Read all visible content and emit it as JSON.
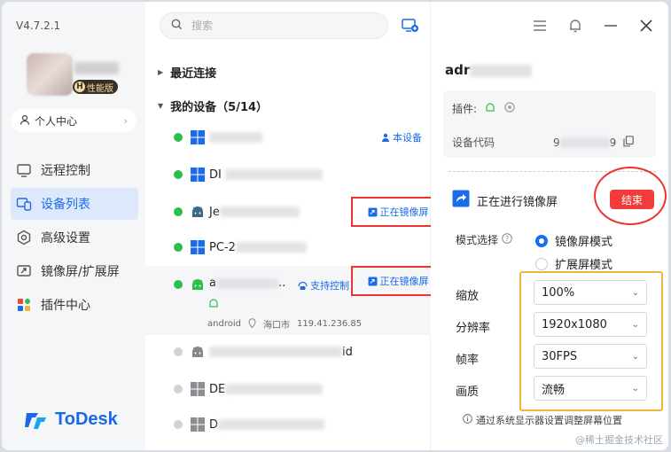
{
  "app": {
    "version": "V4.7.2.1",
    "badge": "性能版",
    "badge_letter": "H",
    "personal_center": "个人中心",
    "logo_text": "ToDesk"
  },
  "sidebar": {
    "items": [
      {
        "label": "远程控制",
        "icon": "remote-control-icon"
      },
      {
        "label": "设备列表",
        "icon": "device-list-icon",
        "active": true
      },
      {
        "label": "高级设置",
        "icon": "settings-icon"
      },
      {
        "label": "镜像屏/扩展屏",
        "icon": "mirror-screen-icon"
      },
      {
        "label": "插件中心",
        "icon": "plugin-center-icon"
      }
    ]
  },
  "search": {
    "placeholder": "搜索"
  },
  "device_list": {
    "recent_label": "最近连接",
    "my_devices_label": "我的设备（5/14）",
    "devices": [
      {
        "os": "windows",
        "online": true,
        "name": "",
        "tag": "本设备"
      },
      {
        "os": "windows",
        "online": true,
        "name": "DI"
      },
      {
        "os": "android",
        "online": true,
        "name": "Je",
        "status": "正在镜像屏"
      },
      {
        "os": "windows",
        "online": true,
        "name": "PC-2"
      },
      {
        "os": "android",
        "online": true,
        "name": "a",
        "tag": "支持控制",
        "status": "正在镜像屏",
        "meta_os": "android",
        "meta_location": "海口市",
        "meta_ip": "119.41.236.85"
      },
      {
        "os": "android",
        "online": false,
        "name": "",
        "suffix": "id"
      },
      {
        "os": "windows",
        "online": false,
        "name": "DE"
      },
      {
        "os": "windows",
        "online": false,
        "name": "D"
      }
    ]
  },
  "detail": {
    "title": "adr",
    "plugins_label": "插件:",
    "device_code_label": "设备代码",
    "device_code_start": "9",
    "device_code_end": "9",
    "mirror_status": "正在进行镜像屏",
    "end_button": "结束",
    "mode_label": "模式选择",
    "modes": [
      "镜像屏模式",
      "扩展屏模式"
    ],
    "selected_mode": "镜像屏模式",
    "settings": [
      {
        "label": "缩放",
        "value": "100%"
      },
      {
        "label": "分辨率",
        "value": "1920x1080"
      },
      {
        "label": "帧率",
        "value": "30FPS"
      },
      {
        "label": "画质",
        "value": "流畅"
      }
    ],
    "hint": "通过系统显示器设置调整屏幕位置"
  },
  "watermark": "@稀土掘金技术社区",
  "colors": {
    "accent": "#1b6ce8",
    "online": "#2bc04a",
    "danger": "#f23c3c",
    "highlight_box": "#f0b43a"
  }
}
